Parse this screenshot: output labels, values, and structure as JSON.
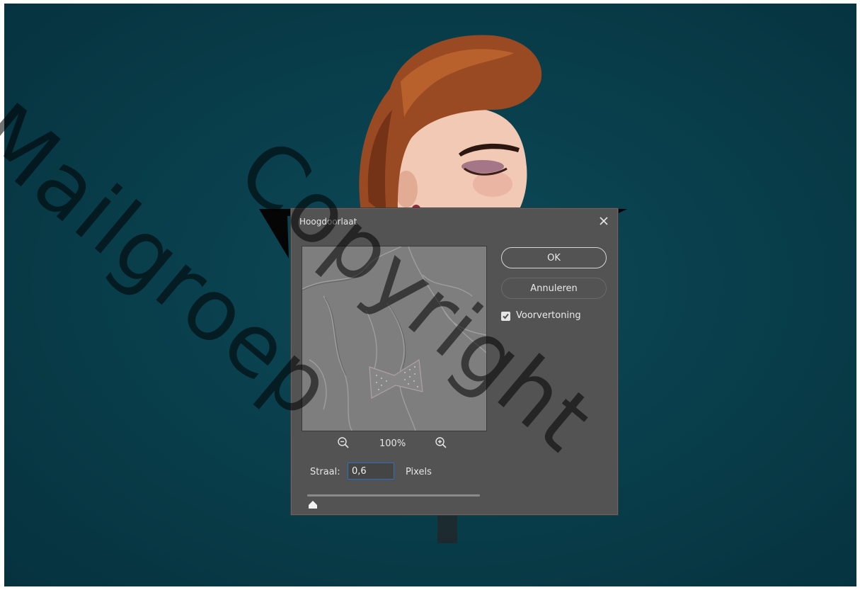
{
  "dialog": {
    "title": "Hoogdoorlaat",
    "ok_label": "OK",
    "cancel_label": "Annuleren",
    "preview_label": "Voorvertoning",
    "preview_checked": true,
    "zoom_level": "100%",
    "radius_label": "Straal:",
    "radius_value": "0,6",
    "radius_unit": "Pixels",
    "radius_slider_fraction": 0.01
  },
  "icons": {
    "close": "close-icon",
    "zoom_out": "zoom-out-icon",
    "zoom_in": "zoom-in-icon",
    "checkbox": "checkmark-icon",
    "slider": "slider-thumb-icon"
  },
  "watermark": {
    "line1": "Mailgroep",
    "line2": "Copyright"
  },
  "colors": {
    "canvas_bg": "#093f4c",
    "dialog_bg": "#535353",
    "input_border": "#2b6fbf"
  }
}
